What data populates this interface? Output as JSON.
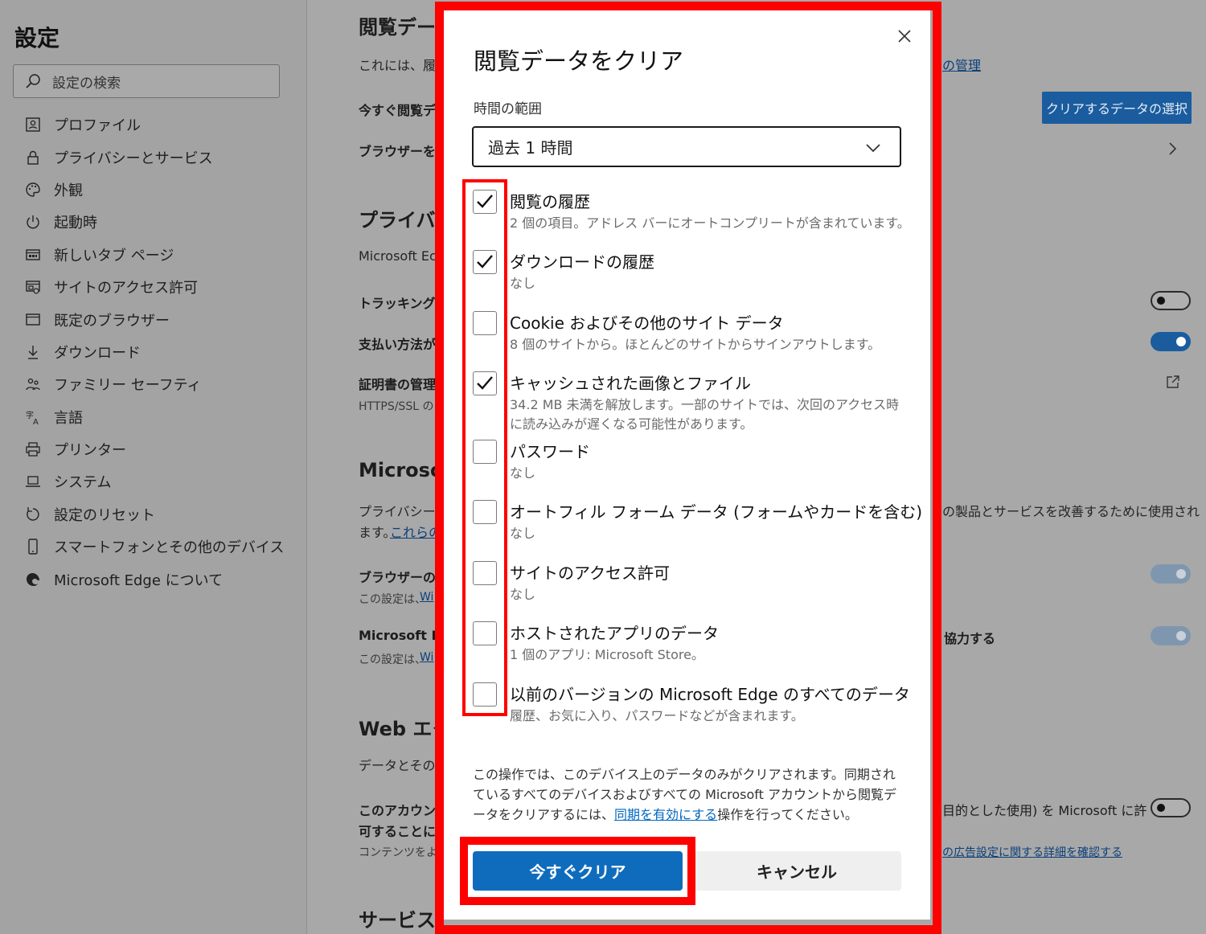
{
  "sidebar": {
    "title": "設定",
    "search_placeholder": "設定の検索",
    "items": [
      {
        "label": "プロファイル",
        "icon": "profile-icon"
      },
      {
        "label": "プライバシーとサービス",
        "icon": "lock-icon"
      },
      {
        "label": "外観",
        "icon": "palette-icon"
      },
      {
        "label": "起動時",
        "icon": "power-icon"
      },
      {
        "label": "新しいタブ ページ",
        "icon": "new-tab-icon"
      },
      {
        "label": "サイトのアクセス許可",
        "icon": "site-permissions-icon"
      },
      {
        "label": "既定のブラウザー",
        "icon": "browser-icon"
      },
      {
        "label": "ダウンロード",
        "icon": "download-icon"
      },
      {
        "label": "ファミリー セーフティ",
        "icon": "family-icon"
      },
      {
        "label": "言語",
        "icon": "language-icon"
      },
      {
        "label": "プリンター",
        "icon": "printer-icon"
      },
      {
        "label": "システム",
        "icon": "laptop-icon"
      },
      {
        "label": "設定のリセット",
        "icon": "reset-icon"
      },
      {
        "label": "スマートフォンとその他のデバイス",
        "icon": "phone-icon"
      },
      {
        "label": "Microsoft Edge について",
        "icon": "edge-logo-icon"
      }
    ]
  },
  "background": {
    "section_title": "閲覧デー",
    "intro": "これには、履歴",
    "manage_link": "の管理",
    "clear_now_label": "今すぐ閲覧デ",
    "choose_button": "クリアするデータの選択",
    "on_close_label": "ブラウザーを閉",
    "privacy_title": "プライバシ",
    "ms_edge_text": "Microsoft Ec",
    "tracking_label": "トラッキング拒",
    "payment_label": "支払い方法が",
    "cert_label": "証明書の管理",
    "https_text": "HTTPS/SSL の",
    "microsoft_title": "Microso",
    "privacy_desc": "プライバシーお",
    "privacy_desc2": "ます。",
    "these_link": "これらの",
    "improve_text": "の製品とサービスを改善するために使用され",
    "browser_usage_label": "ブラウザーの使",
    "setting_wi_1": "この設定は、",
    "wi_link_1": "Wi",
    "ms_edge_label2": "Microsoft Ec",
    "cooperate_text": "協力する",
    "setting_wi_2": "この設定は、",
    "wi_link_2": "Wi",
    "web_ext_title": "Web エク",
    "data_text": "データとその他",
    "account_label": "このアカウント",
    "account_label2": "可することによ",
    "purpose_text": "目的とした使用) を Microsoft に許",
    "content_text": "コンテンツをより",
    "ad_link": "の広告設定に関する詳細を確認する",
    "services_title": "サービス"
  },
  "dialog": {
    "title": "閲覧データをクリア",
    "range_label": "時間の範囲",
    "range_value": "過去 1 時間",
    "options": [
      {
        "label": "閲覧の履歴",
        "desc": "2 個の項目。アドレス バーにオートコンプリートが含まれています。",
        "checked": true
      },
      {
        "label": "ダウンロードの履歴",
        "desc": "なし",
        "checked": true
      },
      {
        "label": "Cookie およびその他のサイト データ",
        "desc": "8 個のサイトから。ほとんどのサイトからサインアウトします。",
        "checked": false
      },
      {
        "label": "キャッシュされた画像とファイル",
        "desc": "34.2 MB 未満を解放します。一部のサイトでは、次回のアクセス時に読み込みが遅くなる可能性があります。",
        "checked": true
      },
      {
        "label": "パスワード",
        "desc": "なし",
        "checked": false
      },
      {
        "label": "オートフィル フォーム データ (フォームやカードを含む)",
        "desc": "なし",
        "checked": false
      },
      {
        "label": "サイトのアクセス許可",
        "desc": "なし",
        "checked": false
      },
      {
        "label": "ホストされたアプリのデータ",
        "desc": "1 個のアプリ: Microsoft Store。",
        "checked": false
      },
      {
        "label": "以前のバージョンの Microsoft Edge のすべてのデータ",
        "desc": "履歴、お気に入り、パスワードなどが含まれます。",
        "checked": false
      }
    ],
    "note_before": "この操作では、このデバイス上のデータのみがクリアされます。同期されているすべてのデバイスおよびすべての Microsoft アカウントから閲覧データをクリアするには、",
    "note_link": "同期を有効にする",
    "note_after": "操作を行ってください。",
    "clear_button": "今すぐクリア",
    "cancel_button": "キャンセル"
  },
  "colors": {
    "highlight": "#ff0000",
    "primary": "#0f6cbd",
    "checkmark": "#111111"
  }
}
